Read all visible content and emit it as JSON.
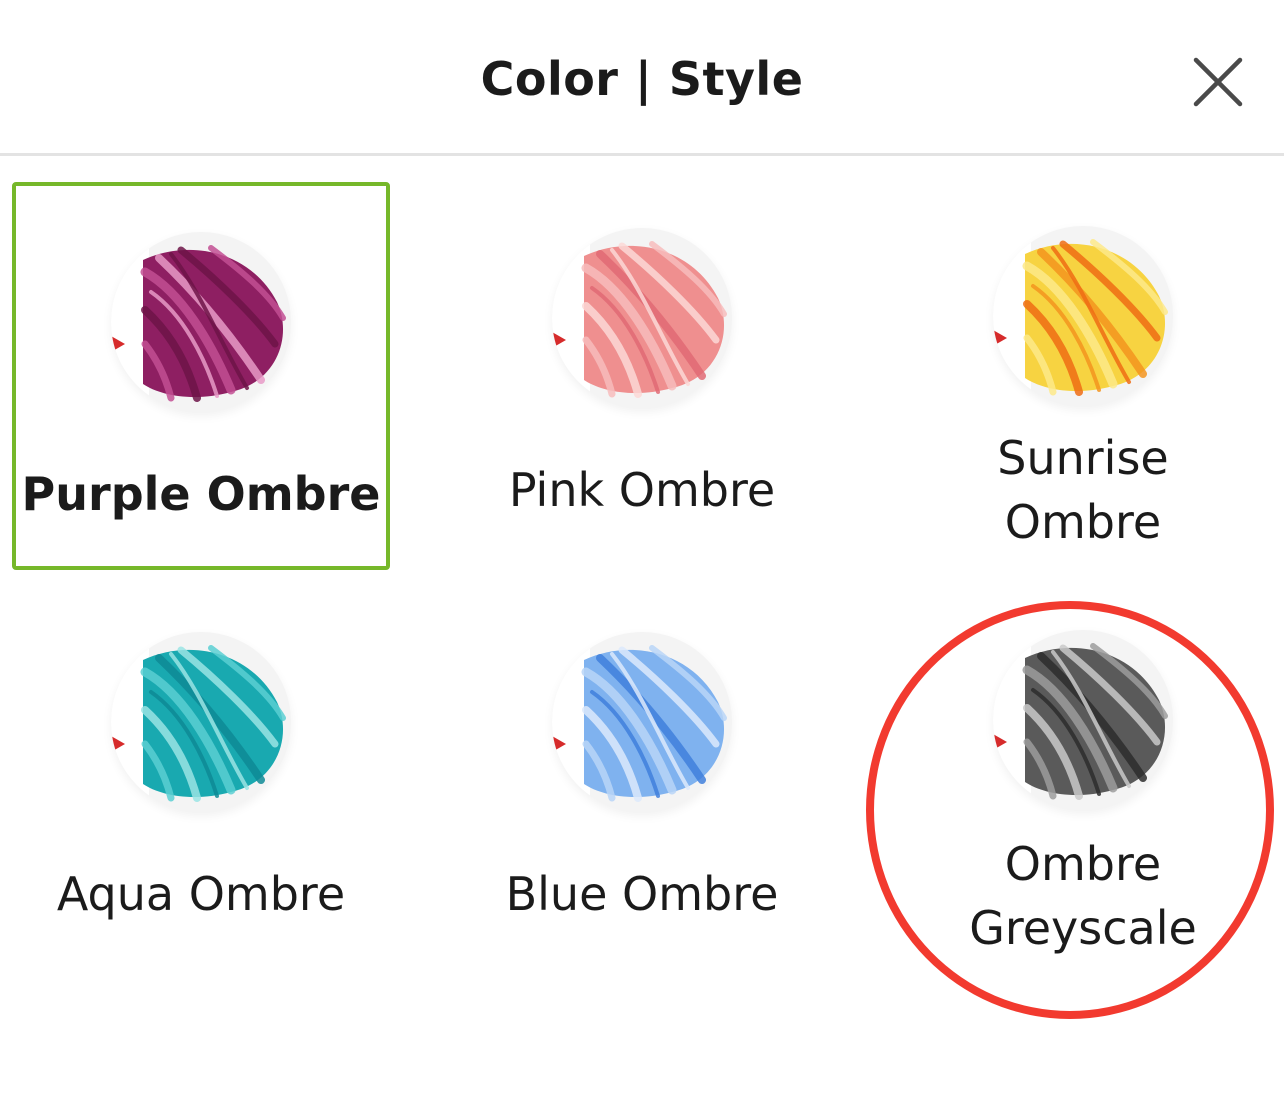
{
  "header": {
    "title": "Color | Style",
    "close_icon": "close-icon"
  },
  "swatches": [
    {
      "label": "Purple Ombre",
      "selected": true,
      "colors": [
        "#8e1f62",
        "#c24f93",
        "#e79ac7",
        "#6d1448"
      ]
    },
    {
      "label": "Pink Ombre",
      "selected": false,
      "colors": [
        "#ef8f8f",
        "#f7bcbc",
        "#e16a74",
        "#fbd8d6"
      ]
    },
    {
      "label": "Sunrise\nOmbre",
      "selected": false,
      "colors": [
        "#f7d341",
        "#fde98a",
        "#f3941f",
        "#ef6c14"
      ]
    },
    {
      "label": "Aqua Ombre",
      "selected": false,
      "colors": [
        "#19a9b0",
        "#5bcfd2",
        "#0e8a95",
        "#9ae4e4"
      ]
    },
    {
      "label": "Blue Ombre",
      "selected": false,
      "colors": [
        "#7fb2ef",
        "#b9d5f7",
        "#3f7fdc",
        "#dce9fb"
      ]
    },
    {
      "label": "Ombre\nGreyscale",
      "selected": false,
      "colors": [
        "#5a5a5a",
        "#9c9c9c",
        "#2d2d2d",
        "#c9c9c9"
      ]
    }
  ],
  "colors": {
    "selected_border": "#76b82a",
    "annotation": "#f23a2f"
  }
}
